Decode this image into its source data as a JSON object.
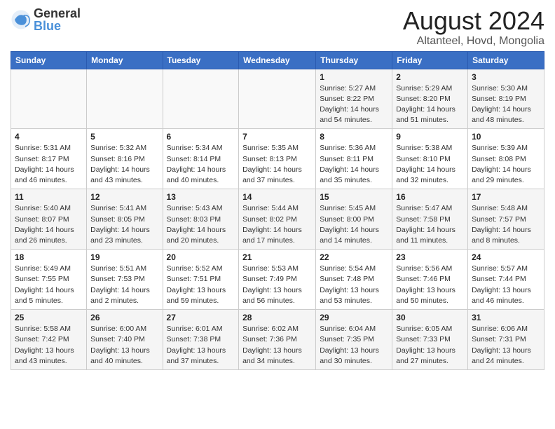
{
  "logo": {
    "general": "General",
    "blue": "Blue"
  },
  "title": "August 2024",
  "location": "Altanteel, Hovd, Mongolia",
  "weekdays": [
    "Sunday",
    "Monday",
    "Tuesday",
    "Wednesday",
    "Thursday",
    "Friday",
    "Saturday"
  ],
  "weeks": [
    [
      {
        "day": "",
        "info": ""
      },
      {
        "day": "",
        "info": ""
      },
      {
        "day": "",
        "info": ""
      },
      {
        "day": "",
        "info": ""
      },
      {
        "day": "1",
        "info": "Sunrise: 5:27 AM\nSunset: 8:22 PM\nDaylight: 14 hours\nand 54 minutes."
      },
      {
        "day": "2",
        "info": "Sunrise: 5:29 AM\nSunset: 8:20 PM\nDaylight: 14 hours\nand 51 minutes."
      },
      {
        "day": "3",
        "info": "Sunrise: 5:30 AM\nSunset: 8:19 PM\nDaylight: 14 hours\nand 48 minutes."
      }
    ],
    [
      {
        "day": "4",
        "info": "Sunrise: 5:31 AM\nSunset: 8:17 PM\nDaylight: 14 hours\nand 46 minutes."
      },
      {
        "day": "5",
        "info": "Sunrise: 5:32 AM\nSunset: 8:16 PM\nDaylight: 14 hours\nand 43 minutes."
      },
      {
        "day": "6",
        "info": "Sunrise: 5:34 AM\nSunset: 8:14 PM\nDaylight: 14 hours\nand 40 minutes."
      },
      {
        "day": "7",
        "info": "Sunrise: 5:35 AM\nSunset: 8:13 PM\nDaylight: 14 hours\nand 37 minutes."
      },
      {
        "day": "8",
        "info": "Sunrise: 5:36 AM\nSunset: 8:11 PM\nDaylight: 14 hours\nand 35 minutes."
      },
      {
        "day": "9",
        "info": "Sunrise: 5:38 AM\nSunset: 8:10 PM\nDaylight: 14 hours\nand 32 minutes."
      },
      {
        "day": "10",
        "info": "Sunrise: 5:39 AM\nSunset: 8:08 PM\nDaylight: 14 hours\nand 29 minutes."
      }
    ],
    [
      {
        "day": "11",
        "info": "Sunrise: 5:40 AM\nSunset: 8:07 PM\nDaylight: 14 hours\nand 26 minutes."
      },
      {
        "day": "12",
        "info": "Sunrise: 5:41 AM\nSunset: 8:05 PM\nDaylight: 14 hours\nand 23 minutes."
      },
      {
        "day": "13",
        "info": "Sunrise: 5:43 AM\nSunset: 8:03 PM\nDaylight: 14 hours\nand 20 minutes."
      },
      {
        "day": "14",
        "info": "Sunrise: 5:44 AM\nSunset: 8:02 PM\nDaylight: 14 hours\nand 17 minutes."
      },
      {
        "day": "15",
        "info": "Sunrise: 5:45 AM\nSunset: 8:00 PM\nDaylight: 14 hours\nand 14 minutes."
      },
      {
        "day": "16",
        "info": "Sunrise: 5:47 AM\nSunset: 7:58 PM\nDaylight: 14 hours\nand 11 minutes."
      },
      {
        "day": "17",
        "info": "Sunrise: 5:48 AM\nSunset: 7:57 PM\nDaylight: 14 hours\nand 8 minutes."
      }
    ],
    [
      {
        "day": "18",
        "info": "Sunrise: 5:49 AM\nSunset: 7:55 PM\nDaylight: 14 hours\nand 5 minutes."
      },
      {
        "day": "19",
        "info": "Sunrise: 5:51 AM\nSunset: 7:53 PM\nDaylight: 14 hours\nand 2 minutes."
      },
      {
        "day": "20",
        "info": "Sunrise: 5:52 AM\nSunset: 7:51 PM\nDaylight: 13 hours\nand 59 minutes."
      },
      {
        "day": "21",
        "info": "Sunrise: 5:53 AM\nSunset: 7:49 PM\nDaylight: 13 hours\nand 56 minutes."
      },
      {
        "day": "22",
        "info": "Sunrise: 5:54 AM\nSunset: 7:48 PM\nDaylight: 13 hours\nand 53 minutes."
      },
      {
        "day": "23",
        "info": "Sunrise: 5:56 AM\nSunset: 7:46 PM\nDaylight: 13 hours\nand 50 minutes."
      },
      {
        "day": "24",
        "info": "Sunrise: 5:57 AM\nSunset: 7:44 PM\nDaylight: 13 hours\nand 46 minutes."
      }
    ],
    [
      {
        "day": "25",
        "info": "Sunrise: 5:58 AM\nSunset: 7:42 PM\nDaylight: 13 hours\nand 43 minutes."
      },
      {
        "day": "26",
        "info": "Sunrise: 6:00 AM\nSunset: 7:40 PM\nDaylight: 13 hours\nand 40 minutes."
      },
      {
        "day": "27",
        "info": "Sunrise: 6:01 AM\nSunset: 7:38 PM\nDaylight: 13 hours\nand 37 minutes."
      },
      {
        "day": "28",
        "info": "Sunrise: 6:02 AM\nSunset: 7:36 PM\nDaylight: 13 hours\nand 34 minutes."
      },
      {
        "day": "29",
        "info": "Sunrise: 6:04 AM\nSunset: 7:35 PM\nDaylight: 13 hours\nand 30 minutes."
      },
      {
        "day": "30",
        "info": "Sunrise: 6:05 AM\nSunset: 7:33 PM\nDaylight: 13 hours\nand 27 minutes."
      },
      {
        "day": "31",
        "info": "Sunrise: 6:06 AM\nSunset: 7:31 PM\nDaylight: 13 hours\nand 24 minutes."
      }
    ]
  ]
}
